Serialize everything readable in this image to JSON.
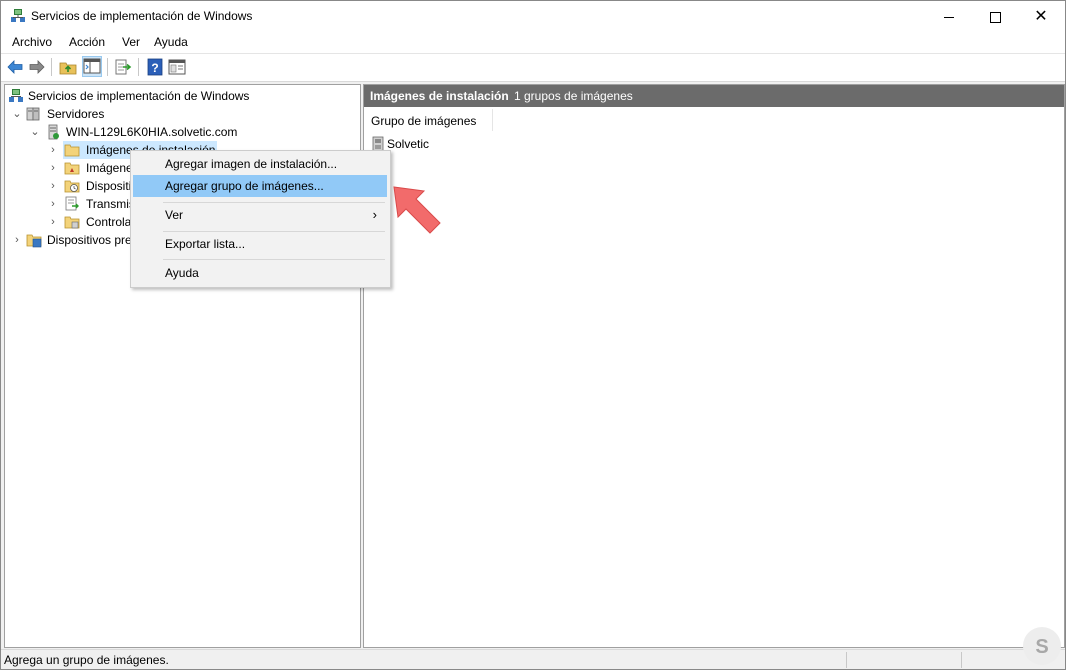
{
  "window": {
    "title": "Servicios de implementación de Windows",
    "close_glyph": "✕"
  },
  "menubar": {
    "items": [
      "Archivo",
      "Acción",
      "Ver",
      "Ayuda"
    ]
  },
  "toolbar": {
    "buttons": [
      "back-icon",
      "forward-icon",
      "up-folder-icon",
      "show-hide-tree-icon",
      "export-list-icon",
      "help-icon",
      "properties-icon"
    ]
  },
  "tree": {
    "root": "Servicios de implementación de Windows",
    "servers": "Servidores",
    "server_name": "WIN-L129L6K0HIA.solvetic.com",
    "items": [
      {
        "label": "Imágenes de instalación"
      },
      {
        "label": "Imágenes de arranque"
      },
      {
        "label": "Dispositivos pendientes"
      },
      {
        "label": "Transmisiones por multidifusión"
      },
      {
        "label": "Controladores"
      }
    ],
    "prestaged": "Dispositivos preconfigurados de Active Directory",
    "visible_labels": [
      "Imágenes de instalación",
      "Imágene",
      "Dispositi",
      "Transmis",
      "Controla",
      "Dispositivos pre"
    ]
  },
  "result_pane": {
    "title": "Imágenes de instalación",
    "count": "1 grupos de imágenes",
    "column_header": "Grupo de imágenes",
    "items": [
      "Solvetic"
    ]
  },
  "context_menu": {
    "items": [
      {
        "label": "Agregar imagen de instalación..."
      },
      {
        "label": "Agregar grupo de imágenes...",
        "highlighted": true
      },
      {
        "label": "Ver",
        "submenu": "›"
      },
      {
        "label": "Exportar lista..."
      },
      {
        "label": "Ayuda"
      }
    ]
  },
  "statusbar": {
    "text": "Agrega un grupo de imágenes."
  },
  "colors": {
    "accent_highlight": "#91c9f7",
    "result_header_bg": "#6b6b6b",
    "annotation_arrow": "#f26b6b"
  }
}
